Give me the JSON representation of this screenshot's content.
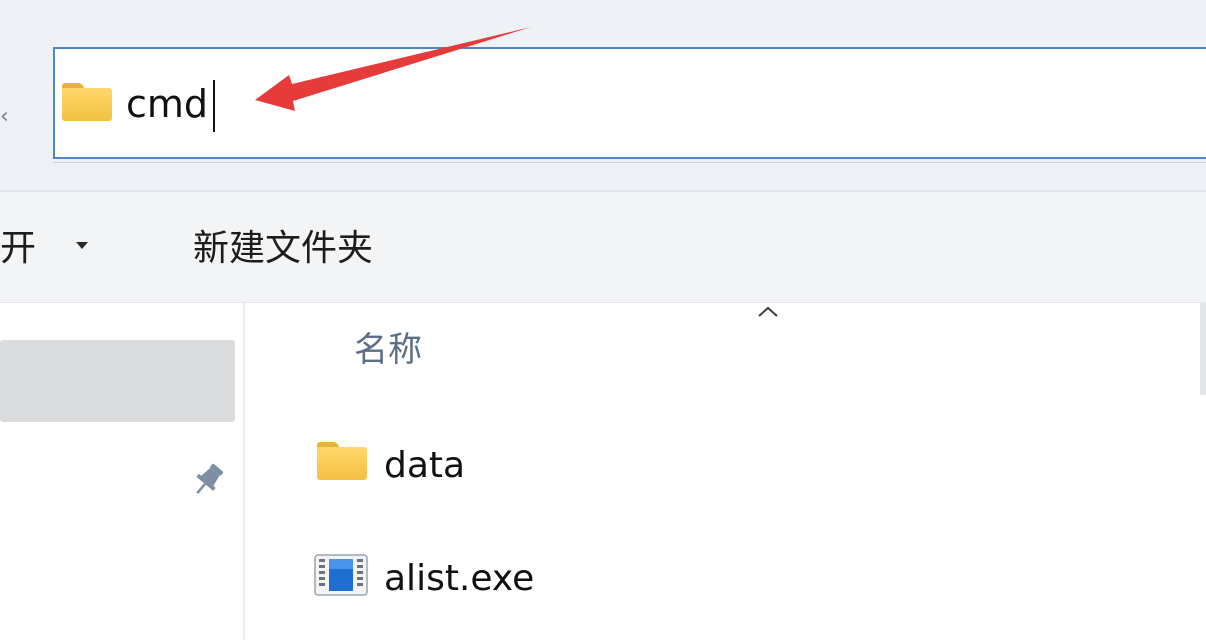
{
  "address_bar": {
    "value": "cmd",
    "icon": "folder-icon"
  },
  "toolbar": {
    "open_label": "开",
    "new_folder_label": "新建文件夹"
  },
  "file_list": {
    "column_name_header": "名称",
    "items": [
      {
        "name": "data",
        "icon": "folder-icon"
      },
      {
        "name": "alist.exe",
        "icon": "exe-icon"
      }
    ]
  },
  "colors": {
    "accent_border": "#4d86c9",
    "annotation_arrow": "#e53b3b",
    "folder_yellow": "#ffd86a"
  }
}
